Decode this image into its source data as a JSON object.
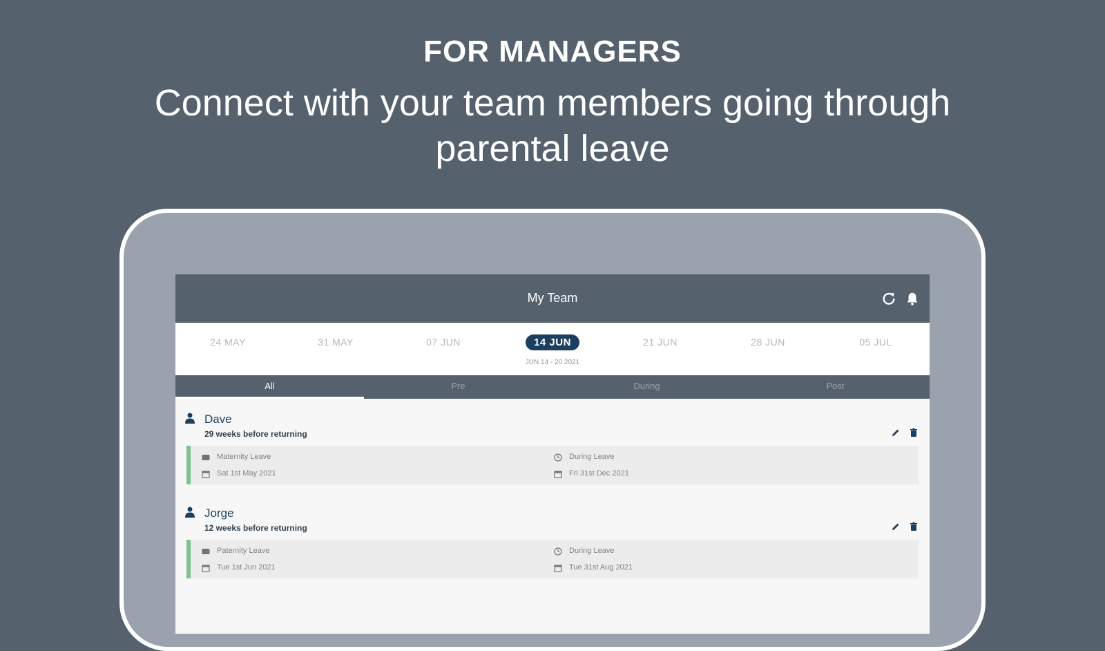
{
  "hero": {
    "eyebrow": "FOR MANAGERS",
    "headline": "Connect with your team members going through parental leave"
  },
  "app": {
    "title": "My Team",
    "icons": {
      "refresh": "refresh-icon",
      "bell": "bell-icon"
    },
    "weeks": [
      "24 MAY",
      "31 MAY",
      "07 JUN",
      "14 JUN",
      "21 JUN",
      "28 JUN",
      "05 JUL"
    ],
    "active_week": "14 JUN",
    "week_range": "JUN 14 - 20 2021",
    "tabs": [
      "All",
      "Pre",
      "During",
      "Post"
    ],
    "active_tab": "All",
    "members": [
      {
        "name": "Dave",
        "weeks_text": "29 weeks before returning",
        "leave_type": "Maternity Leave",
        "start_date": "Sat 1st May 2021",
        "status": "During Leave",
        "end_date": "Fri 31st Dec 2021"
      },
      {
        "name": "Jorge",
        "weeks_text": "12 weeks before returning",
        "leave_type": "Paternity Leave",
        "start_date": "Tue 1st Jun 2021",
        "status": "During Leave",
        "end_date": "Tue 31st Aug 2021"
      }
    ]
  },
  "colors": {
    "background": "#56616e",
    "navy": "#1c3f5e",
    "leave_accent": "#7ec08f"
  }
}
